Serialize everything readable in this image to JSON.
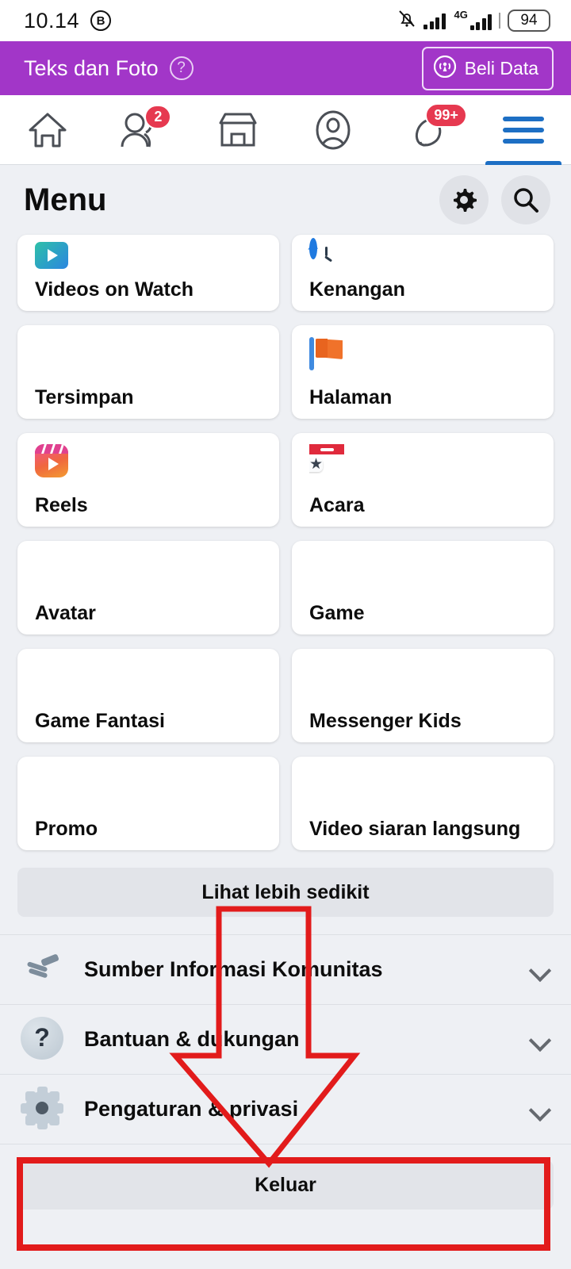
{
  "status_bar": {
    "time": "10.14",
    "mode_badge": "B",
    "icons": [
      "bell-muted-icon",
      "signal-bars-icon",
      "network-4g-icon"
    ],
    "network_label": "4G",
    "battery": "94"
  },
  "banner": {
    "title": "Teks dan Foto",
    "help_icon": "?",
    "buy_button": "Beli Data",
    "color": "#a236c8"
  },
  "navbar": {
    "items": [
      {
        "name": "home",
        "badge": ""
      },
      {
        "name": "friends",
        "badge": "2"
      },
      {
        "name": "marketplace",
        "badge": ""
      },
      {
        "name": "profile",
        "badge": ""
      },
      {
        "name": "notifications",
        "badge": "99+"
      },
      {
        "name": "menu",
        "badge": ""
      }
    ],
    "active": "menu",
    "accent": "#1d6fc4",
    "badge_color": "#e63950"
  },
  "menu_header": {
    "title": "Menu",
    "settings_icon": "gear-icon",
    "search_icon": "search-icon"
  },
  "shortcuts": [
    {
      "label": "Videos on Watch",
      "icon": "watch-icon"
    },
    {
      "label": "Kenangan",
      "icon": "memories-clock-icon"
    },
    {
      "label": "Tersimpan",
      "icon": "bookmark-icon"
    },
    {
      "label": "Halaman",
      "icon": "flag-icon"
    },
    {
      "label": "Reels",
      "icon": "reels-icon"
    },
    {
      "label": "Acara",
      "icon": "calendar-star-icon"
    },
    {
      "label": "Avatar",
      "icon": ""
    },
    {
      "label": "Game",
      "icon": ""
    },
    {
      "label": "Game Fantasi",
      "icon": ""
    },
    {
      "label": "Messenger Kids",
      "icon": ""
    },
    {
      "label": "Promo",
      "icon": ""
    },
    {
      "label": "Video siaran langsung",
      "icon": ""
    }
  ],
  "see_less_label": "Lihat lebih sedikit",
  "sections": [
    {
      "label": "Sumber Informasi Komunitas",
      "icon": "handshake-heart-icon"
    },
    {
      "label": "Bantuan & dukungan",
      "icon": "question-circle-icon"
    },
    {
      "label": "Pengaturan & privasi",
      "icon": "gear-icon"
    }
  ],
  "logout_label": "Keluar",
  "annotation": {
    "type": "arrow-and-highlight",
    "color": "#e21b1b",
    "target": "Keluar"
  }
}
